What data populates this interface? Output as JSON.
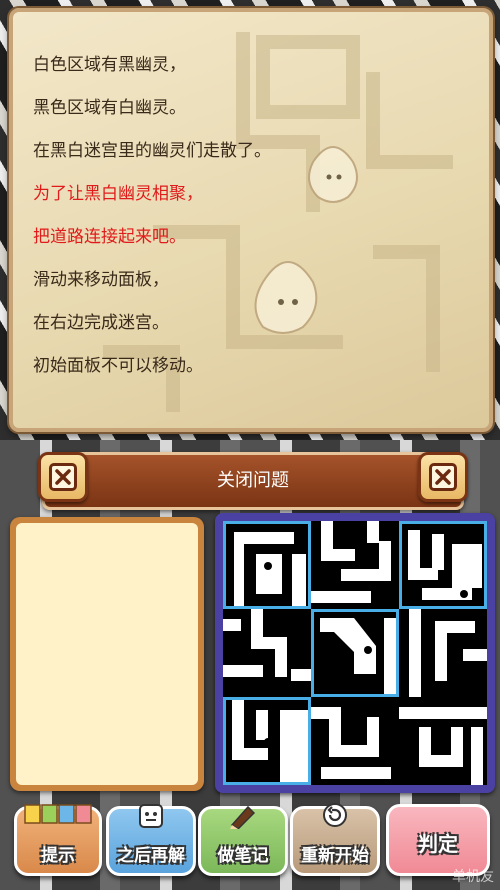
{
  "story": {
    "lines": [
      "白色区域有黑幽灵，",
      "黑色区域有白幽灵。",
      "在黑白迷宫里的幽灵们走散了。",
      "为了让黑白幽灵相聚，",
      "把道路连接起来吧。",
      "滑动来移动面板，",
      "在右边完成迷宫。",
      "初始面板不可以移动。"
    ],
    "highlight_color": "#e01b1b"
  },
  "header": {
    "title": "关闭问题"
  },
  "icons": {
    "left_close": "close-icon",
    "right_close": "close-icon"
  },
  "buttons": {
    "hint": {
      "label": "提示",
      "badge": "1 2 3 S",
      "icon": "hint-cards-icon",
      "color": "#d9894a"
    },
    "later": {
      "label": "之后再解",
      "icon": "face-icon",
      "color": "#5aa3dd"
    },
    "memo": {
      "label": "做笔记",
      "icon": "pencil-icon",
      "color": "#7cb85a"
    },
    "restart": {
      "label": "重新开始",
      "icon": "undo-arrow-icon",
      "color": "#b89a7a"
    },
    "judge": {
      "label": "判定",
      "color": "#f08a95"
    }
  },
  "maze": {
    "rows": 3,
    "cols": 3,
    "selected_tiles": [
      0,
      2,
      4,
      6
    ]
  },
  "watermark": "单机友"
}
